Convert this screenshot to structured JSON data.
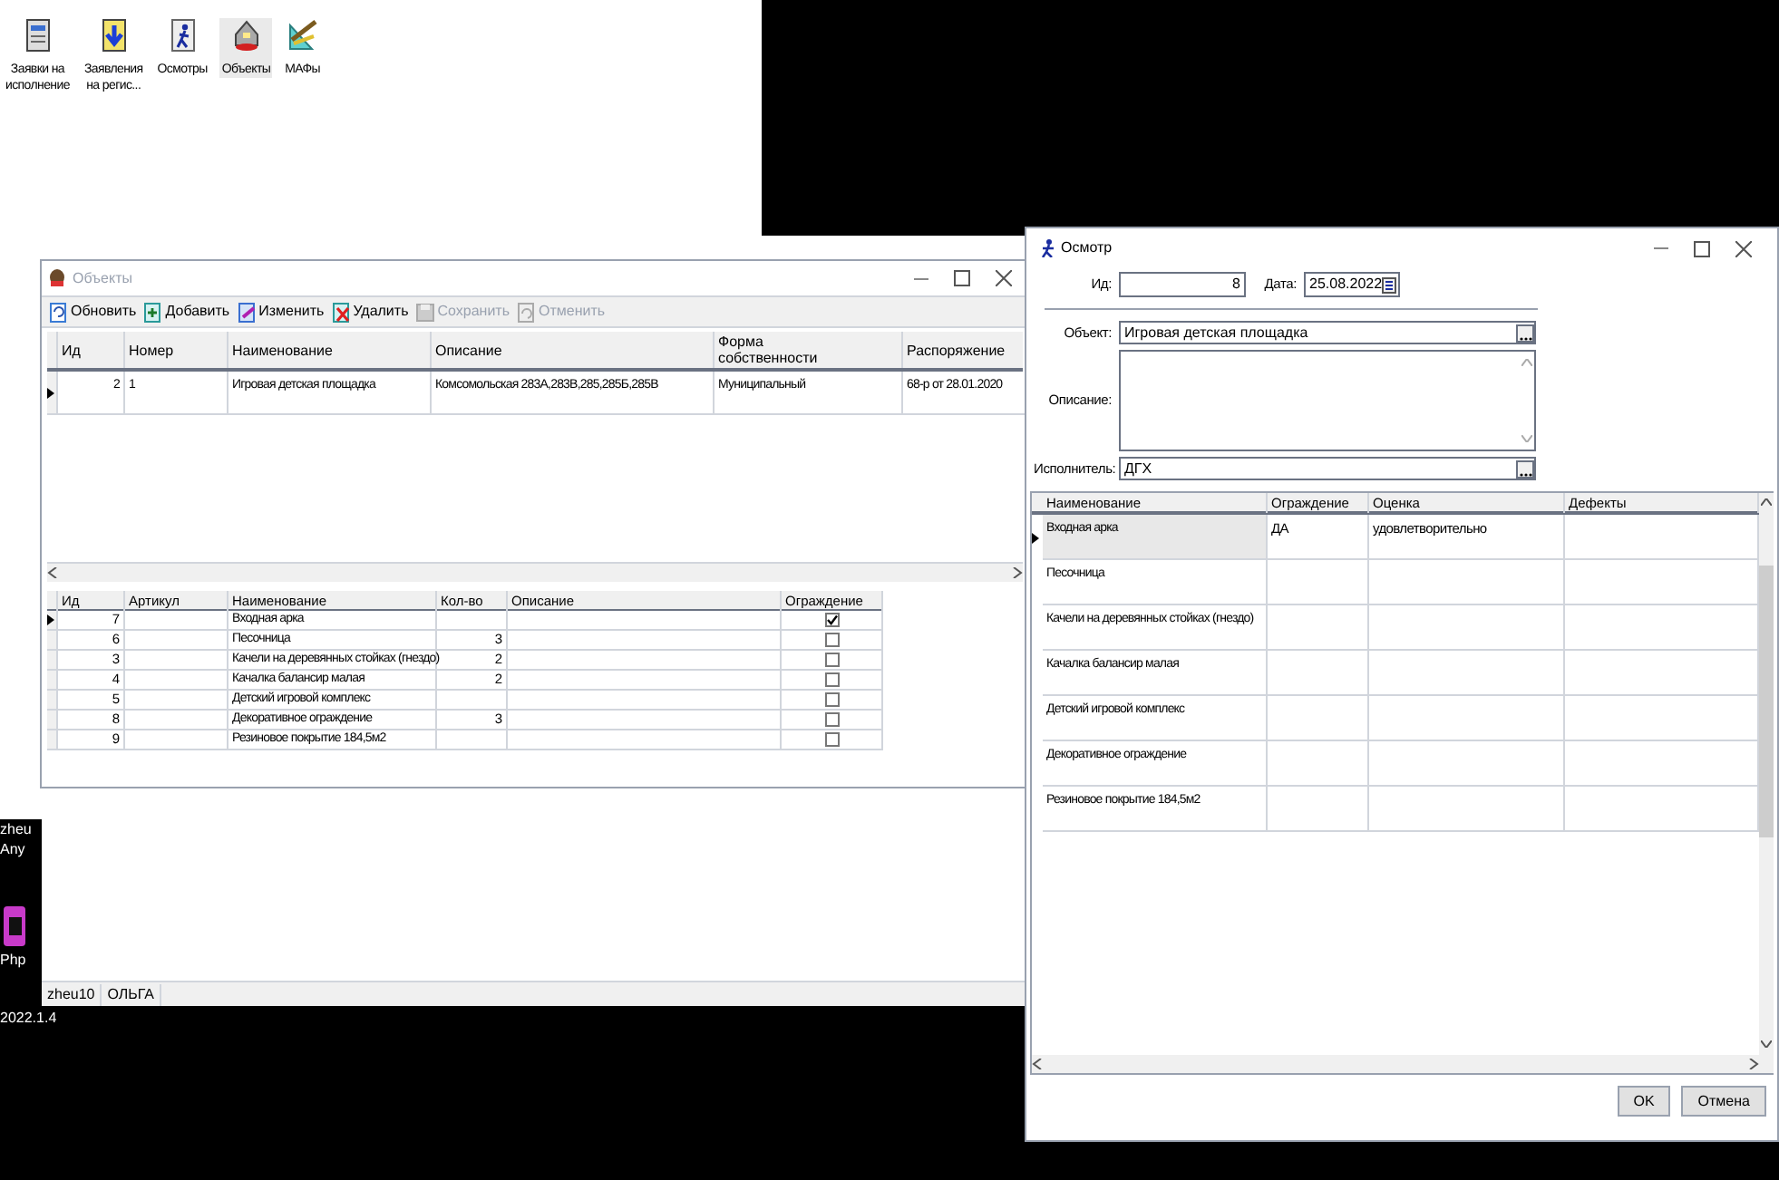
{
  "desktop": {
    "labels": [
      "zheu",
      "Any",
      "Php",
      "2022.1.4"
    ]
  },
  "main_window": {
    "toolbar": [
      {
        "label": "Заявки на\nисполнение",
        "selected": false
      },
      {
        "label": "Заявления\nна регис...",
        "selected": false
      },
      {
        "label": "Осмотры",
        "selected": false
      },
      {
        "label": "Объекты",
        "selected": true
      },
      {
        "label": "МАФы",
        "selected": false
      }
    ],
    "status_bar": [
      "zheu10",
      "ОЛЬГА"
    ]
  },
  "objects_window": {
    "title": "Объекты",
    "toolbar": [
      {
        "label": "Обновить",
        "disabled": false
      },
      {
        "label": "Добавить",
        "disabled": false
      },
      {
        "label": "Изменить",
        "disabled": false
      },
      {
        "label": "Удалить",
        "disabled": false
      },
      {
        "label": "Сохранить",
        "disabled": true
      },
      {
        "label": "Отменить",
        "disabled": true
      }
    ],
    "table": {
      "columns": [
        "Ид",
        "Номер",
        "Наименование",
        "Описание",
        "Форма\nсобственности",
        "Распоряжение"
      ],
      "rows": [
        {
          "cells": [
            "2",
            "1",
            "Игровая детская площадка",
            "Комсомольская 283А,283В,285,285Б,285В",
            "Муниципальный",
            "68-р от 28.01.2020"
          ],
          "selected": true
        }
      ]
    },
    "items": {
      "columns": [
        "Ид",
        "Артикул",
        "Наименование",
        "Кол-во",
        "Описание",
        "Ограждение"
      ],
      "rows": [
        {
          "id": "7",
          "name": "Входная арка",
          "checked": true,
          "selected": true
        },
        {
          "id": "6",
          "name": "Песочница",
          "qty": "3",
          "checked": false,
          "selected": false
        },
        {
          "id": "3",
          "name": "Качели на деревянных стойках (гнездо)",
          "qty": "2",
          "checked": false,
          "selected": false
        },
        {
          "id": "4",
          "name": "Качалка балансир малая",
          "qty": "2",
          "checked": false,
          "selected": false
        },
        {
          "id": "5",
          "name": "Детский игровой комплекс",
          "checked": false,
          "selected": false
        },
        {
          "id": "8",
          "name": "Декоративное ограждение",
          "qty": "3",
          "checked": false,
          "selected": false
        },
        {
          "id": "9",
          "name": "Резиновое покрытие 184,5м2",
          "checked": false,
          "selected": false
        }
      ]
    }
  },
  "inspection_window": {
    "title": "Осмотр",
    "id_label": "Ид:",
    "id": "8",
    "date_label": "Дата:",
    "date": "25.08.2022",
    "object_label": "Объект:",
    "object": "Игровая детская площадка",
    "description_label": "Описание:",
    "executor_label": "Исполнитель:",
    "executor": "ДГХ",
    "table": {
      "columns": [
        "Наименование",
        "Ограждение",
        "Оценка",
        "Дефекты"
      ],
      "rows": [
        {
          "name": "Входная арка",
          "fence": "ДА",
          "rating": "удовлетворительно",
          "selected": true
        },
        {
          "name": "Песочница",
          "selected": false
        },
        {
          "name": "Качели на деревянных стойках (гнездо)",
          "selected": false
        },
        {
          "name": "Качалка балансир малая",
          "selected": false
        },
        {
          "name": "Детский игровой комплекс",
          "selected": false
        },
        {
          "name": "Декоративное ограждение",
          "selected": false
        },
        {
          "name": "Резиновое покрытие 184,5м2",
          "selected": false
        }
      ]
    },
    "buttons": [
      "OK",
      "Отмена"
    ]
  }
}
